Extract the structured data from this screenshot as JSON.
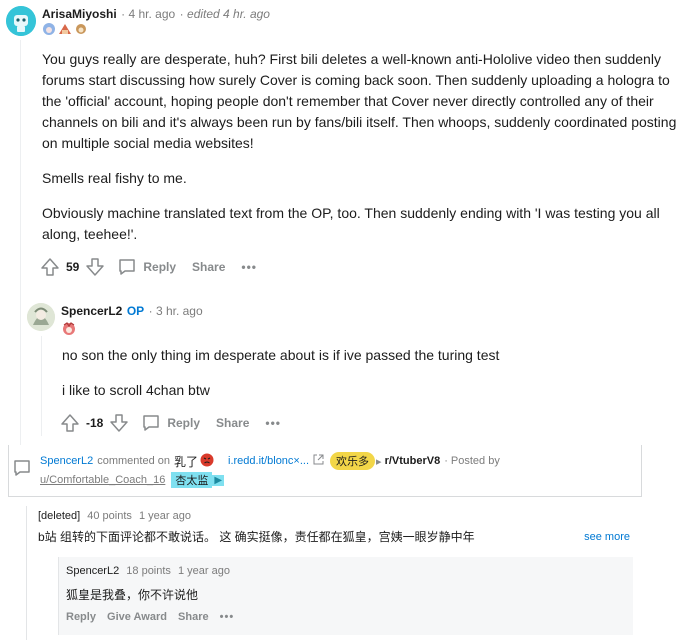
{
  "comment1": {
    "username": "ArisaMiyoshi",
    "time": "4 hr. ago",
    "edited": "edited 4 hr. ago",
    "paragraphs": [
      "You guys really are desperate, huh? First bili deletes a well-known anti-Hololive video then suddenly forums start discussing how surely Cover is coming back soon. Then suddenly uploading a hologra to the 'official' account, hoping people don't remember that Cover never directly controlled any of their channels on bili and it's always been run by fans/bili itself. Then whoops, suddenly coordinated posting on multiple social media websites!",
      "Smells real fishy to me.",
      "Obviously machine translated text from the OP, too. Then suddenly ending with 'I was testing you all along, teehee!'."
    ],
    "votes": "59",
    "reply_label": "Reply",
    "share_label": "Share",
    "more_label": "•••"
  },
  "comment2": {
    "username": "SpencerL2",
    "op_badge": "OP",
    "time": "3 hr. ago",
    "paragraphs": [
      "no son the only thing im desperate about is if ive passed the turing test",
      "i like to scroll 4chan btw"
    ],
    "votes": "-18",
    "reply_label": "Reply",
    "share_label": "Share",
    "more_label": "•••"
  },
  "card": {
    "author": "SpencerL2",
    "commented_on": "commented on",
    "post_title": "乳了",
    "link": "i.redd.it/blonc×...",
    "flair": "欢乐多",
    "subreddit": "r/VtuberV8",
    "posted_by": "· Posted by",
    "poster": "u/Comfortable_Coach_16",
    "poster_flair": "杏太监"
  },
  "old_comment": {
    "author": "[deleted]",
    "points": "40 points",
    "time": "1 year ago",
    "text": "b站 组转的下面评论都不敢说话。 这 确实挺像，责任都在狐皇，宫姨一眼岁静中年",
    "see_more": "see more"
  },
  "old_reply": {
    "author": "SpencerL2",
    "points": "18 points",
    "time": "1 year ago",
    "text": "狐皇是我叠，你不许说他",
    "reply_label": "Reply",
    "award_label": "Give Award",
    "share_label": "Share",
    "more_label": "•••"
  },
  "colors": {
    "accent": "#0079d3",
    "flair_yellow": "#f2d648",
    "flair_cyan": "#7fe0f0",
    "avatar_teal": "#35c4d8"
  }
}
